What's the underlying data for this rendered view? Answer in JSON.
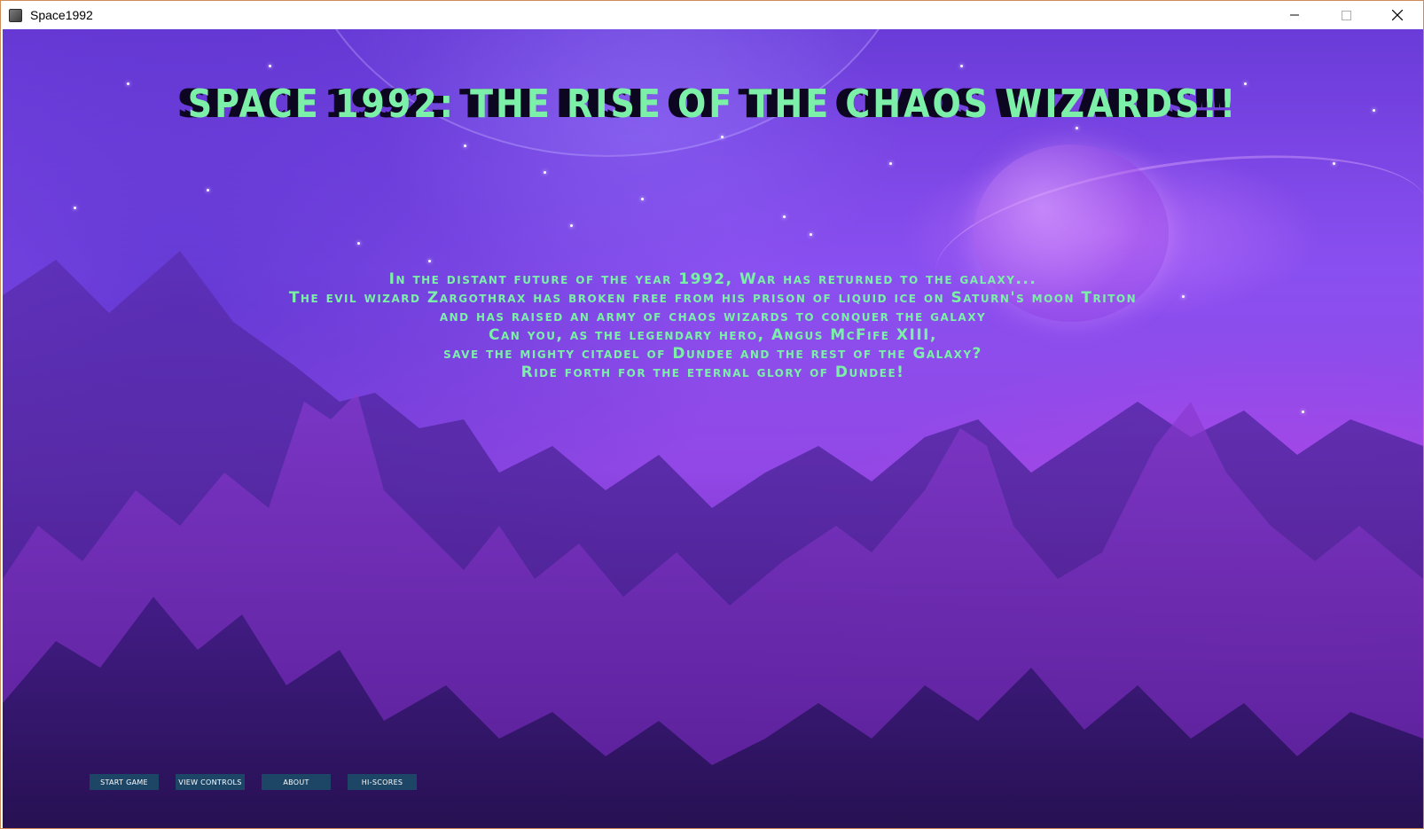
{
  "window": {
    "title": "Space1992",
    "controls": {
      "minimize_icon": "minimize-icon",
      "maximize_icon": "maximize-icon",
      "close_icon": "close-icon"
    }
  },
  "game": {
    "title": "Space 1992: The Rise of the Chaos Wizards!!",
    "intro_lines": [
      "In the distant future of the year 1992, War has returned to the galaxy...",
      "The evil wizard Zargothrax has broken free from his prison of liquid ice on Saturn's moon Triton",
      "and has raised an army of chaos wizards to conquer the galaxy",
      "Can you, as the legendary hero, Angus McFife XIII,",
      "save the mighty citadel of Dundee and the rest of the Galaxy?",
      "Ride forth for the eternal glory of Dundee!"
    ],
    "menu": {
      "start": "START GAME",
      "controls": "VIEW CONTROLS",
      "about": "ABOUT",
      "hiscores": "HI-SCORES"
    }
  },
  "colors": {
    "title_text": "#7cf0a8",
    "title_shadow": "#0c0620",
    "button_bg": "#1c4566",
    "button_text": "#ffffff",
    "sky_top": "#6a3bd8",
    "sky_bottom": "#5a2096"
  }
}
